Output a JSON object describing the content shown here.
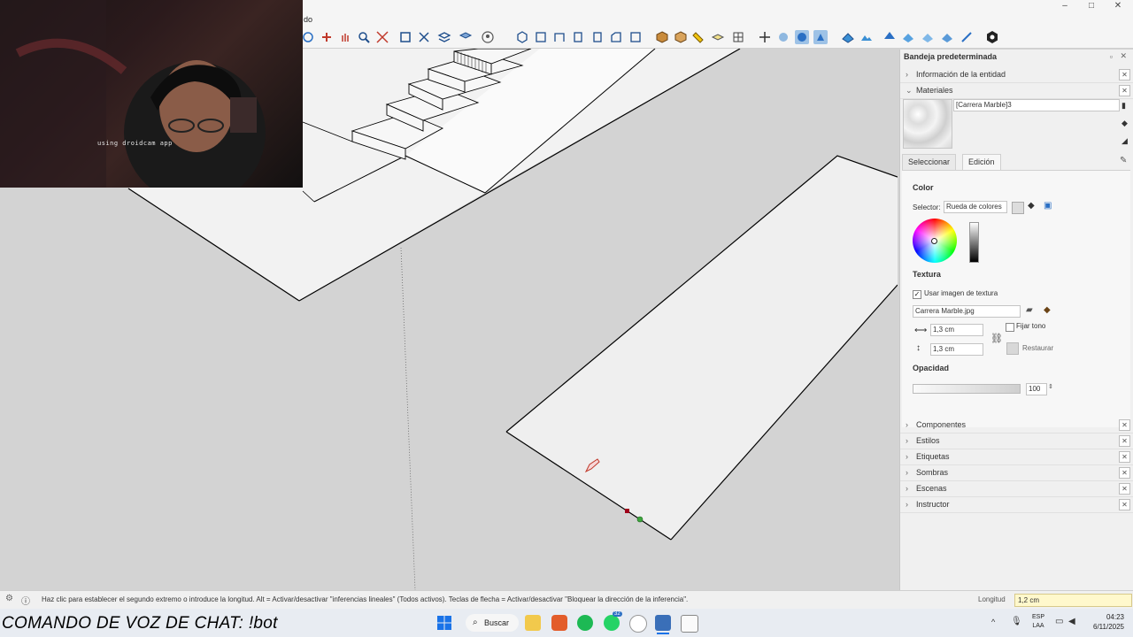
{
  "titlebar": {
    "menu_fragment": "do",
    "win_min": "–",
    "win_max": "□",
    "win_close": "✕"
  },
  "webcam": {
    "watermark": "using droidcam app"
  },
  "tray": {
    "title": "Bandeja predeterminada",
    "sections_top": [
      {
        "label": "Información de la entidad",
        "expanded": false
      },
      {
        "label": "Materiales",
        "expanded": true
      }
    ],
    "materials": {
      "name": "[Carrera Marble]3",
      "tabs": [
        "Seleccionar",
        "Edición"
      ],
      "active_tab": "Edición",
      "color_heading": "Color",
      "selector_label": "Selector:",
      "selector_value": "Rueda de colores",
      "texture_heading": "Textura",
      "use_texture_label": "Usar imagen de textura",
      "use_texture_checked": true,
      "texture_file": "Carrera Marble.jpg",
      "width_value": "1,3 cm",
      "height_value": "1,3 cm",
      "colorize_label": "Fijar tono",
      "reset_label": "Restaurar",
      "opacity_heading": "Opacidad",
      "opacity_value": "100"
    },
    "sections_bottom": [
      {
        "label": "Componentes"
      },
      {
        "label": "Estilos"
      },
      {
        "label": "Etiquetas"
      },
      {
        "label": "Sombras"
      },
      {
        "label": "Escenas"
      },
      {
        "label": "Instructor"
      }
    ]
  },
  "statusbar": {
    "message": "Haz clic para establecer el segundo extremo o introduce la longitud.  Alt = Activar/desactivar \"inferencias lineales\" (Todos activos).  Teclas de flecha = Activar/desactivar \"Bloquear la dirección de la inferencia\".",
    "length_label": "Longitud",
    "length_value": "1,2 cm"
  },
  "overlay": {
    "chat_command": "COMANDO DE VOZ DE CHAT: !bot"
  },
  "taskbar": {
    "search_label": "Buscar",
    "lang_line1": "ESP",
    "lang_line2": "LAA",
    "time": "04:23",
    "date": "6/11/2025",
    "whatsapp_badge": "32"
  },
  "colors": {
    "viewport_bg": "#d3d3d3",
    "face": "#efefef",
    "edge": "#000000",
    "active_tool": "#9ec2e6",
    "length_box": "#fff8cc"
  }
}
